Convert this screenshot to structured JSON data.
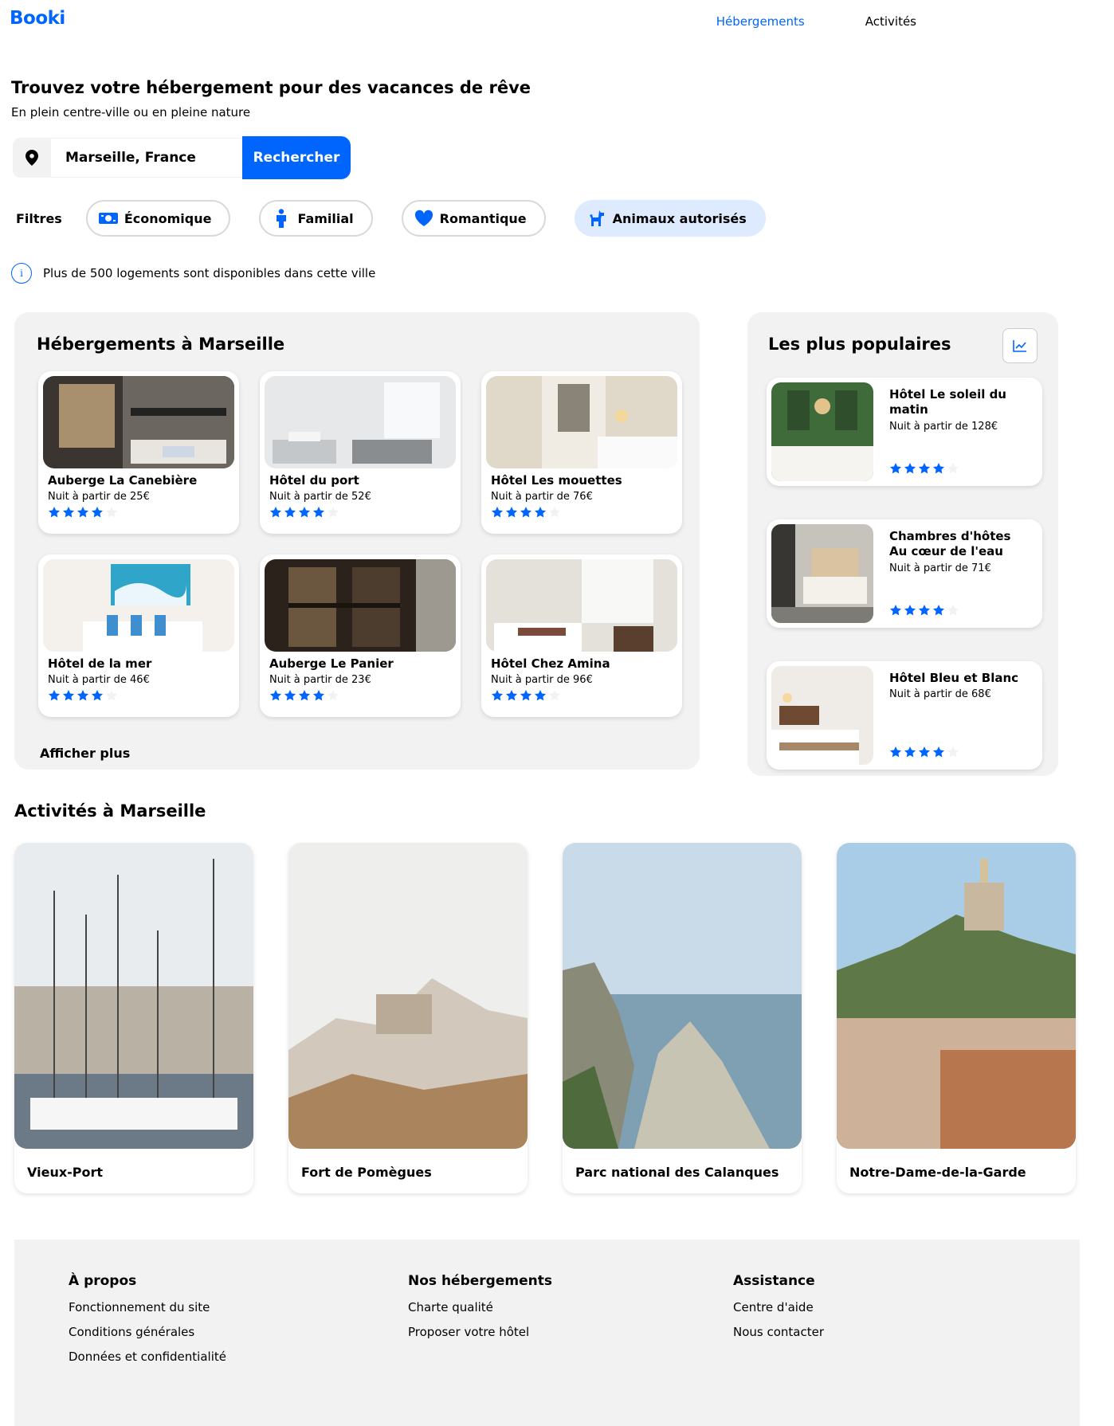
{
  "header": {
    "logo": "Booki",
    "nav": [
      {
        "label": "Hébergements",
        "active": true
      },
      {
        "label": "Activités",
        "active": false
      }
    ]
  },
  "hero": {
    "title": "Trouvez votre hébergement pour des vacances de rêve",
    "subtitle": "En plein centre-ville ou en pleine nature"
  },
  "search": {
    "value": "Marseille, France",
    "button": "Rechercher",
    "icon": "location-pin-icon"
  },
  "filters": {
    "label": "Filtres",
    "chips": [
      {
        "label": "Économique",
        "icon": "money-icon",
        "selected": false
      },
      {
        "label": "Familial",
        "icon": "child-icon",
        "selected": false
      },
      {
        "label": "Romantique",
        "icon": "heart-icon",
        "selected": false
      },
      {
        "label": "Animaux autorisés",
        "icon": "dog-icon",
        "selected": true
      }
    ]
  },
  "info": {
    "text": "Plus de 500 logements sont disponibles dans cette ville",
    "icon": "info-icon"
  },
  "hebergements": {
    "title": "Hébergements à Marseille",
    "items": [
      {
        "name": "Auberge La Canebière",
        "price": "Nuit à partir de 25€",
        "rating": 4
      },
      {
        "name": "Hôtel du port",
        "price": "Nuit à partir de 52€",
        "rating": 4
      },
      {
        "name": "Hôtel Les mouettes",
        "price": "Nuit à partir de 76€",
        "rating": 4
      },
      {
        "name": "Hôtel de la mer",
        "price": "Nuit à partir de 46€",
        "rating": 4
      },
      {
        "name": "Auberge Le Panier",
        "price": "Nuit à partir de 23€",
        "rating": 4
      },
      {
        "name": "Hôtel Chez Amina",
        "price": "Nuit à partir de 96€",
        "rating": 4
      }
    ],
    "show_more": "Afficher plus"
  },
  "populaires": {
    "title": "Les plus populaires",
    "icon": "trend-chart-icon",
    "items": [
      {
        "name": "Hôtel Le soleil du matin",
        "price": "Nuit à partir de 128€",
        "rating": 4
      },
      {
        "name": "Chambres d'hôtes Au cœur de l'eau",
        "price": "Nuit à partir de 71€",
        "rating": 4
      },
      {
        "name": "Hôtel Bleu et Blanc",
        "price": "Nuit à partir de 68€",
        "rating": 4
      }
    ]
  },
  "activites": {
    "title": "Activités à Marseille",
    "items": [
      {
        "label": "Vieux-Port"
      },
      {
        "label": "Fort de Pomègues"
      },
      {
        "label": "Parc national des Calanques"
      },
      {
        "label": "Notre-Dame-de-la-Garde"
      }
    ]
  },
  "footer": {
    "columns": [
      {
        "title": "À propos",
        "links": [
          "Fonctionnement du site",
          "Conditions générales",
          "Données et confidentialité"
        ]
      },
      {
        "title": "Nos hébergements",
        "links": [
          "Charte qualité",
          "Proposer votre hôtel"
        ]
      },
      {
        "title": "Assistance",
        "links": [
          "Centre d'aide",
          "Nous contacter"
        ]
      }
    ]
  },
  "colors": {
    "primary": "#0065FC",
    "secondary": "#DEEBFF",
    "background": "#F2F2F2",
    "star_empty": "#F2F2F2"
  }
}
